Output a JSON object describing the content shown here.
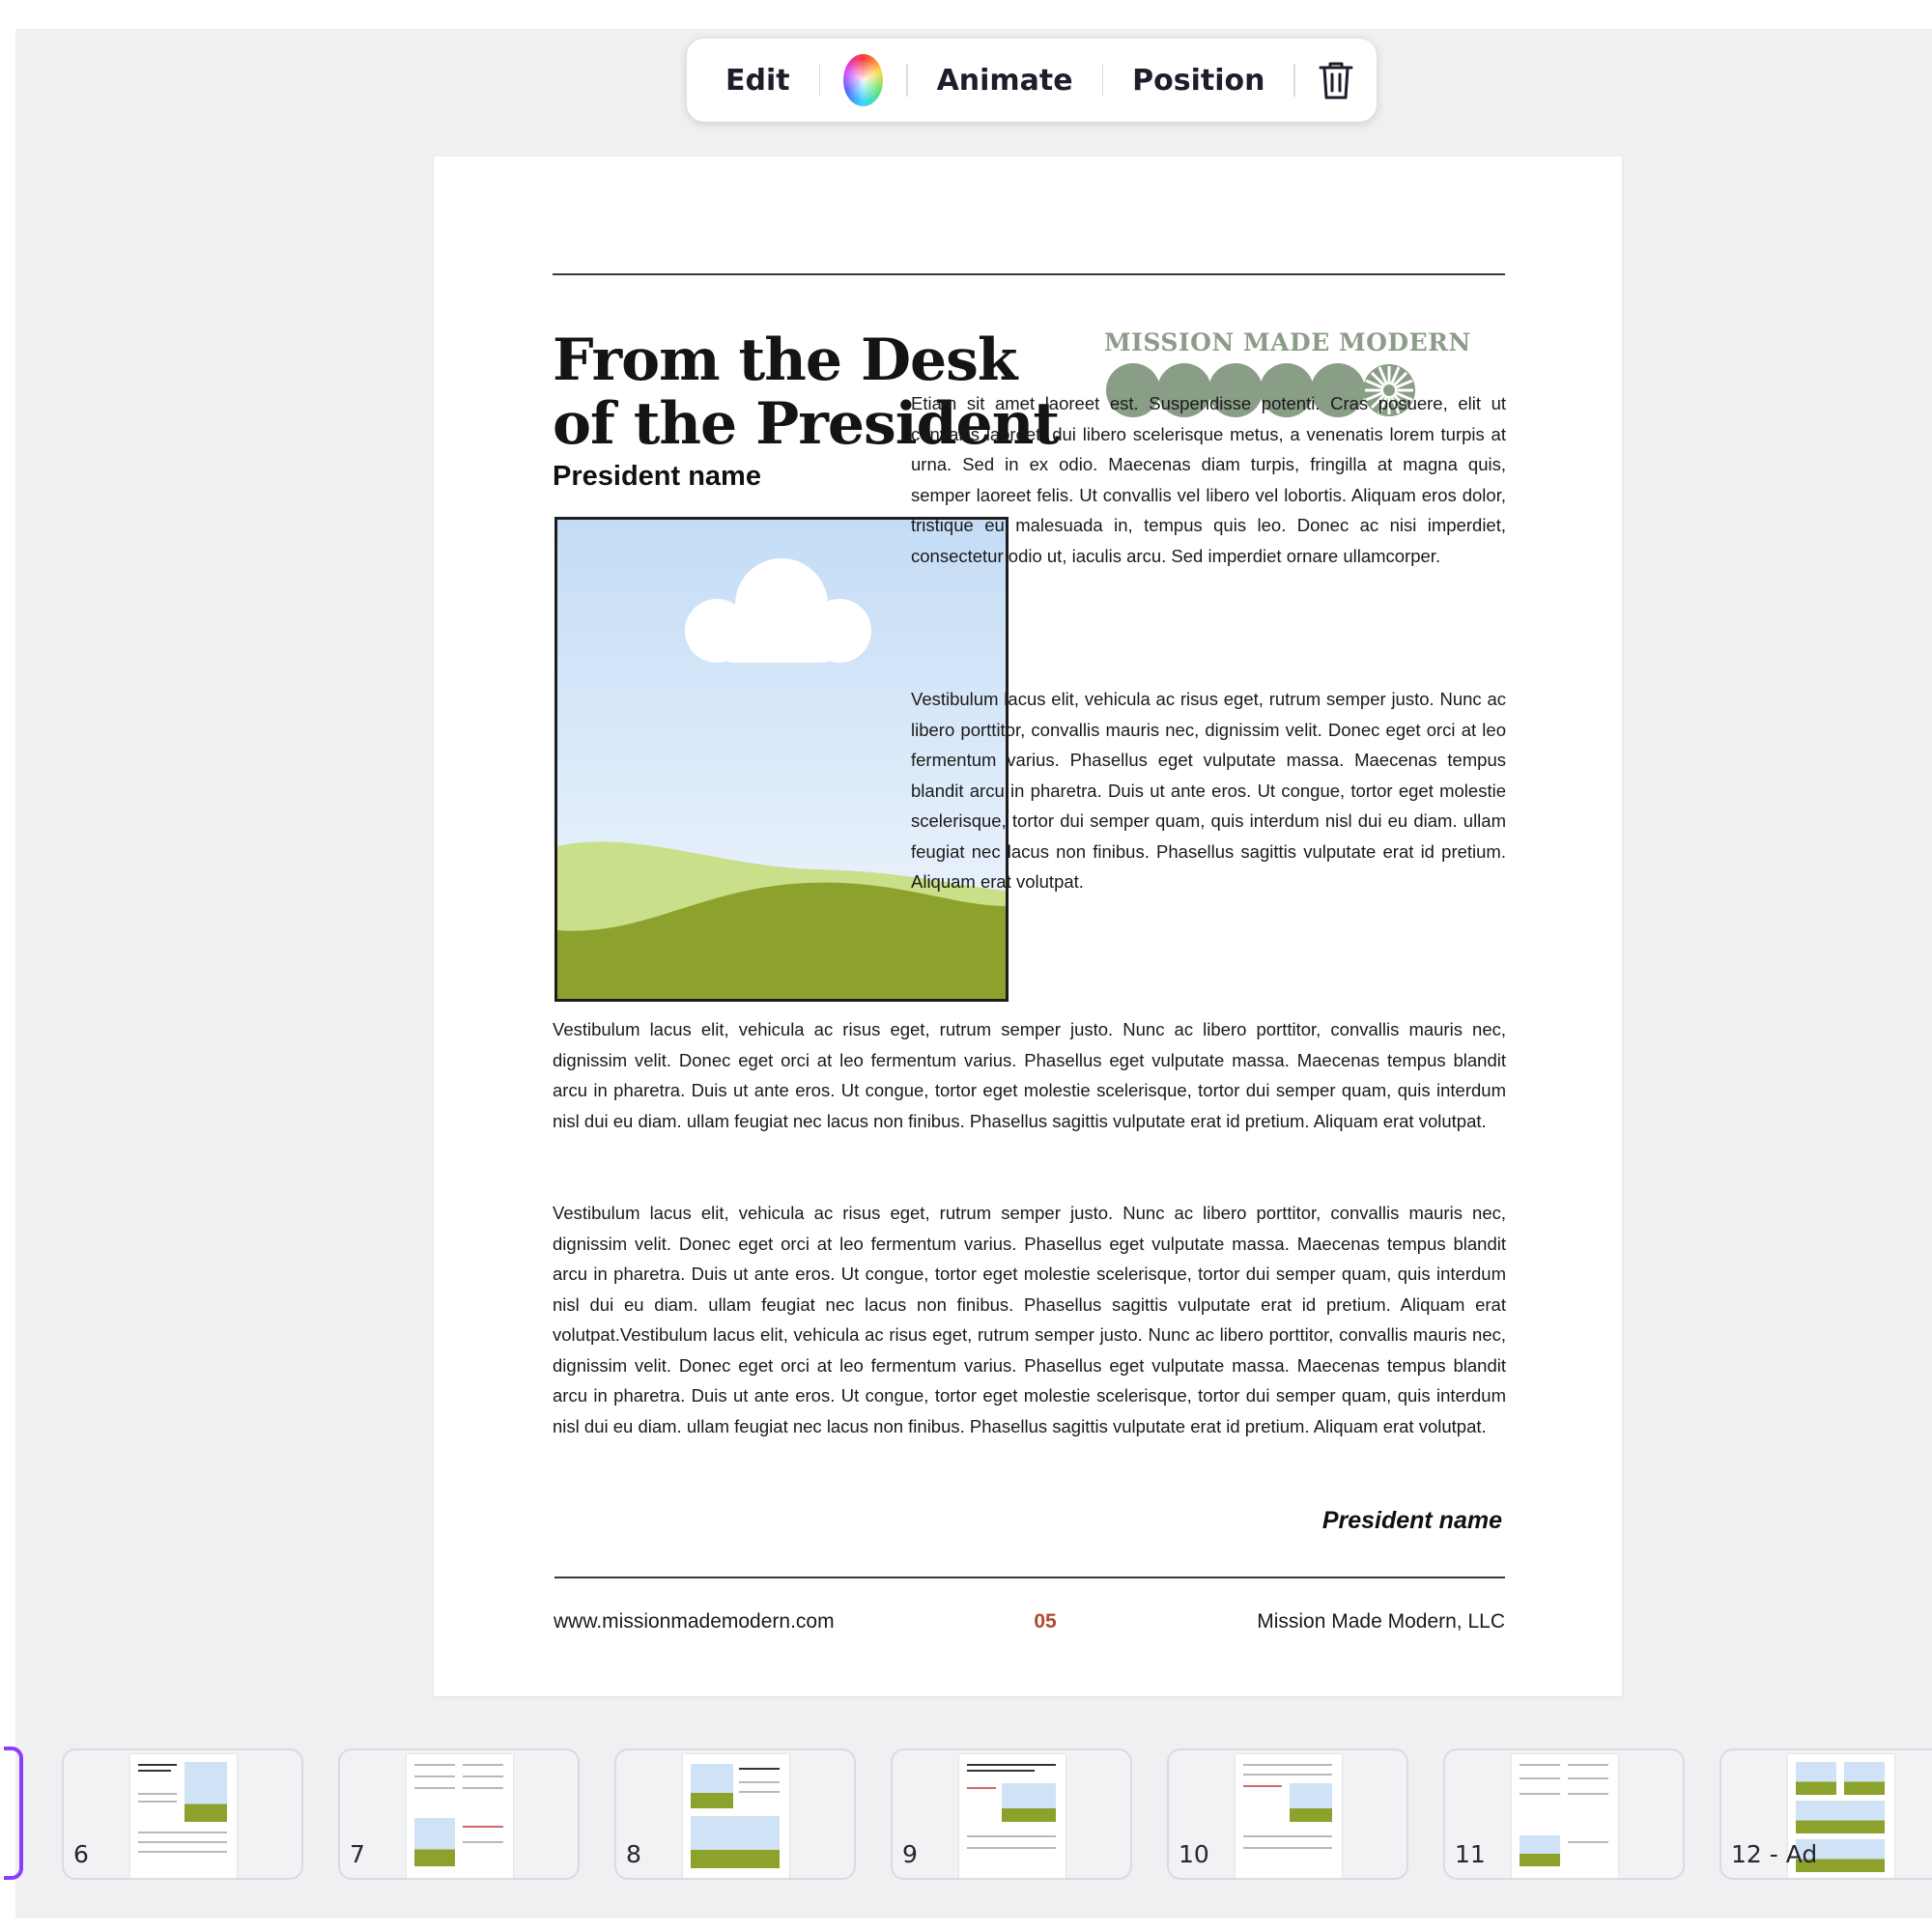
{
  "toolbar": {
    "edit_label": "Edit",
    "animate_label": "Animate",
    "position_label": "Position"
  },
  "page": {
    "headline": "From the Desk of the President",
    "president_name": "President name",
    "logo_text": "MISSION MADE MODERN",
    "right_para_1": "Etiam sit amet laoreet est. Suspendisse potenti. Cras posuere, elit ut convallis laoreet, dui libero scelerisque metus, a venenatis lorem turpis at urna. Sed in ex odio. Maecenas diam turpis, fringilla at magna quis, semper laoreet felis. Ut convallis vel libero vel lobortis. Aliquam eros dolor, tristique eu malesuada in, tempus quis leo. Donec ac nisi imperdiet, consectetur odio ut, iaculis arcu. Sed imperdiet ornare ullamcorper.",
    "right_para_2": "Vestibulum lacus elit, vehicula ac risus eget, rutrum semper justo. Nunc ac libero porttitor, convallis mauris nec, dignissim velit. Donec eget orci at leo fermentum varius. Phasellus eget vulputate massa. Maecenas tempus blandit arcu in pharetra. Duis ut ante eros. Ut congue, tortor eget molestie scelerisque, tortor dui semper quam, quis interdum nisl dui eu diam. ullam feugiat nec lacus non finibus. Phasellus sagittis vulputate erat id pretium. Aliquam erat volutpat.",
    "full_para_1": "Vestibulum lacus elit, vehicula ac risus eget, rutrum semper justo. Nunc ac libero porttitor, convallis mauris nec, dignissim velit. Donec eget orci at leo fermentum varius. Phasellus eget vulputate massa. Maecenas tempus blandit arcu in pharetra. Duis ut ante eros. Ut congue, tortor eget molestie scelerisque, tortor dui semper quam, quis interdum nisl dui eu diam. ullam feugiat nec lacus non finibus. Phasellus sagittis vulputate erat id pretium. Aliquam erat volutpat.",
    "full_para_2": "Vestibulum lacus elit, vehicula ac risus eget, rutrum semper justo. Nunc ac libero porttitor, convallis mauris nec, dignissim velit. Donec eget orci at leo fermentum varius. Phasellus eget vulputate massa. Maecenas tempus blandit arcu in pharetra. Duis ut ante eros. Ut congue, tortor eget molestie scelerisque, tortor dui semper quam, quis interdum nisl dui eu diam. ullam feugiat nec lacus non finibus. Phasellus sagittis vulputate erat id pretium. Aliquam erat volutpat.Vestibulum lacus elit, vehicula ac risus eget, rutrum semper justo. Nunc ac libero porttitor, convallis mauris nec, dignissim velit. Donec eget orci at leo fermentum varius. Phasellus eget vulputate massa. Maecenas tempus blandit arcu in pharetra. Duis ut ante eros. Ut congue, tortor eget molestie scelerisque, tortor dui semper quam, quis interdum nisl dui eu diam. ullam feugiat nec lacus non finibus. Phasellus sagittis vulputate erat id pretium. Aliquam erat volutpat.",
    "signature": "President name",
    "footer_url": "www.missionmademodern.com",
    "page_number": "05",
    "footer_company": "Mission Made Modern, LLC"
  },
  "thumbnails": [
    {
      "label": "6"
    },
    {
      "label": "7"
    },
    {
      "label": "8"
    },
    {
      "label": "9"
    },
    {
      "label": "10"
    },
    {
      "label": "11"
    },
    {
      "label": "12 - Ad"
    }
  ],
  "colors": {
    "accent": "#8b3dff",
    "logo_green": "#8a9d86",
    "page_number": "#b04a2c",
    "grass": "#8ca22c",
    "sky": "#d5e6f7"
  },
  "icons": {
    "color": "color-picker-icon",
    "delete": "trash-icon",
    "cloud": "cloud-icon"
  }
}
